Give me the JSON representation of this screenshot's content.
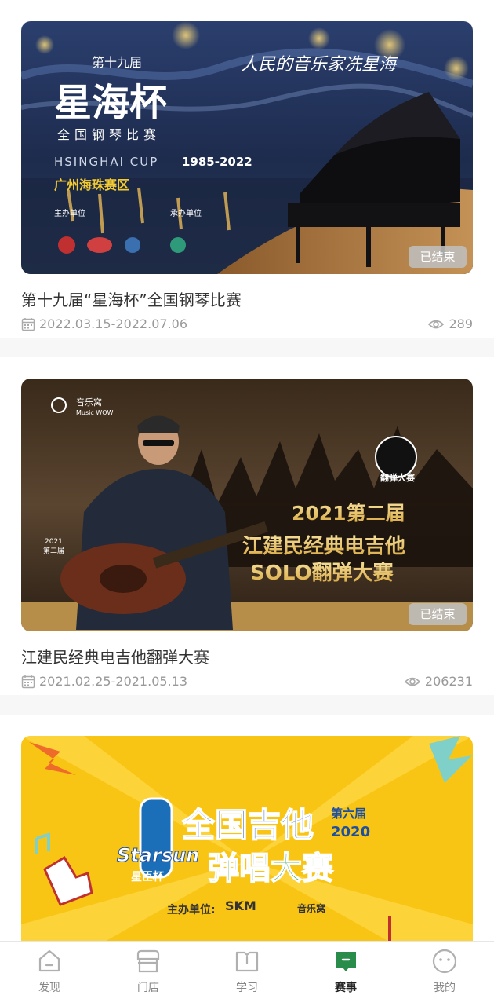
{
  "colors": {
    "accent": "#2a8c4a",
    "badge_bg": "#bdbdbd",
    "muted_text": "#999999",
    "title_text": "#333333"
  },
  "events": [
    {
      "title": "第十九届“星海杯”全国钢琴比赛",
      "date_range": "2022.03.15-2022.07.06",
      "views": "289",
      "status": "已结束",
      "banner": {
        "edition": "第十九届",
        "name": "星海杯",
        "subtitle": "全国钢琴比赛",
        "cup": "HSINGHAI CUP",
        "years": "1985-2022",
        "region": "广州海珠赛区",
        "slogan": "人民的音乐家冼星海",
        "organizer_label": "主办单位",
        "co_organizer_label": "承办单位"
      }
    },
    {
      "title": "江建民经典电吉他翻弹大赛",
      "date_range": "2021.02.25-2021.05.13",
      "views": "206231",
      "status": "已结束",
      "banner": {
        "brand": "音乐窝",
        "brand_en": "Music WOW",
        "line1": "2021第二届",
        "line2": "江建民经典电吉他",
        "line3": "SOLO翻弹大赛",
        "seal": "翻弹大赛",
        "guitar_year": "2021",
        "guitar_edition": "第二届"
      }
    },
    {
      "banner": {
        "title": "全国吉他",
        "edition": "第六届",
        "year": "2020",
        "subtitle": "弹唱大赛",
        "brand": "Starsun",
        "brand_cn": "星臣杯",
        "organizer_label": "主办单位:",
        "sponsor": "SKM",
        "brand2": "音乐窝"
      }
    }
  ],
  "tabs": [
    {
      "label": "发现",
      "icon": "discover-icon",
      "active": false
    },
    {
      "label": "门店",
      "icon": "store-icon",
      "active": false
    },
    {
      "label": "学习",
      "icon": "book-icon",
      "active": false
    },
    {
      "label": "赛事",
      "icon": "contest-icon",
      "active": true
    },
    {
      "label": "我的",
      "icon": "profile-icon",
      "active": false
    }
  ]
}
